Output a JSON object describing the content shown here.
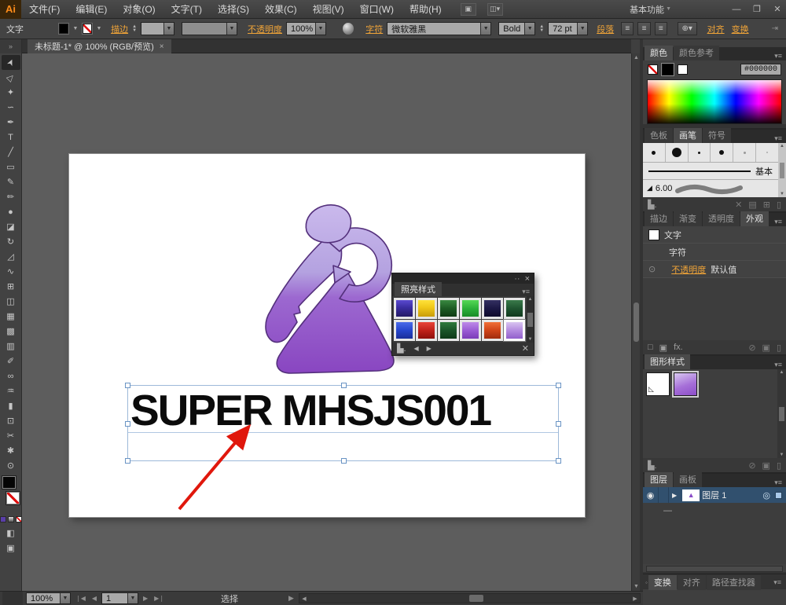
{
  "colors": {
    "accent_orange": "#f0a438",
    "selection_blue": "#9db9d9",
    "canvas_gray": "#5d5d5d",
    "layer_selected_blue": "#31506e",
    "arrow_red": "#e0170c",
    "logo_purple_light": "#cdbcee",
    "logo_purple_dark": "#8844c0",
    "fill_color": "#000000"
  },
  "menubar": {
    "app_icon": "Ai",
    "items": [
      "文件(F)",
      "编辑(E)",
      "对象(O)",
      "文字(T)",
      "选择(S)",
      "效果(C)",
      "视图(V)",
      "窗口(W)",
      "帮助(H)"
    ],
    "workspace": "基本功能",
    "win_min": "—",
    "win_restore": "❐",
    "win_close": "✕"
  },
  "controlbar": {
    "context_label": "文字",
    "stroke_label": "描边",
    "opacity_label": "不透明度",
    "opacity_value": "100%",
    "character_label": "字符",
    "font_family": "微软雅黑",
    "font_style": "Bold",
    "font_size": "72 pt",
    "paragraph_label": "段落",
    "align_label": "对齐",
    "transform_label": "变换"
  },
  "document_tab": {
    "title": "未标题-1* @ 100% (RGB/预览)",
    "close": "×"
  },
  "toolbar": {
    "tools": [
      {
        "name": "selection",
        "glyph": "➤"
      },
      {
        "name": "direct-selection",
        "glyph": "▷"
      },
      {
        "name": "magic-wand",
        "glyph": "✦"
      },
      {
        "name": "lasso",
        "glyph": "∽"
      },
      {
        "name": "pen",
        "glyph": "✒"
      },
      {
        "name": "type",
        "glyph": "T"
      },
      {
        "name": "line-segment",
        "glyph": "╱"
      },
      {
        "name": "rectangle",
        "glyph": "▭"
      },
      {
        "name": "paintbrush",
        "glyph": "✎"
      },
      {
        "name": "pencil",
        "glyph": "✏"
      },
      {
        "name": "blob-brush",
        "glyph": "●"
      },
      {
        "name": "eraser",
        "glyph": "◪"
      },
      {
        "name": "rotate",
        "glyph": "↻"
      },
      {
        "name": "scale",
        "glyph": "◿"
      },
      {
        "name": "width",
        "glyph": "∿"
      },
      {
        "name": "free-transform",
        "glyph": "⊞"
      },
      {
        "name": "shape-builder",
        "glyph": "◫"
      },
      {
        "name": "perspective-grid",
        "glyph": "▦"
      },
      {
        "name": "mesh",
        "glyph": "▩"
      },
      {
        "name": "gradient",
        "glyph": "▥"
      },
      {
        "name": "eyedropper",
        "glyph": "✐"
      },
      {
        "name": "blend",
        "glyph": "∞"
      },
      {
        "name": "symbol-sprayer",
        "glyph": "♒"
      },
      {
        "name": "column-graph",
        "glyph": "▮"
      },
      {
        "name": "artboard",
        "glyph": "⊡"
      },
      {
        "name": "slice",
        "glyph": "✂"
      },
      {
        "name": "hand",
        "glyph": "✱"
      },
      {
        "name": "zoom",
        "glyph": "⊙"
      }
    ]
  },
  "canvas": {
    "headline": "SUPER MHSJS001"
  },
  "float_panel": {
    "title": "照亮样式",
    "collapse": "··",
    "close": "×",
    "menu_icon": "▾≡",
    "swatches": [
      {
        "name": "style-indigo",
        "css": "background:linear-gradient(180deg,#5a49d0,#3a2da0 45%,#241a66)"
      },
      {
        "name": "style-yellow",
        "css": "background:linear-gradient(180deg,#ffe23a,#f0c818 45%,#c89c0a)"
      },
      {
        "name": "style-dark-green",
        "css": "background:linear-gradient(180deg,#3a8a40,#1d5c24 50%,#0f3a14)"
      },
      {
        "name": "style-green",
        "css": "background:linear-gradient(180deg,#55d855,#2cb23a 50%,#1a8c28)"
      },
      {
        "name": "style-navy",
        "css": "background:linear-gradient(180deg,#343061,#1c1845 50%,#0e0b2c)"
      },
      {
        "name": "style-forest",
        "css": "background:linear-gradient(180deg,#3a7a4a,#1f5530 50%,#113a1e)"
      },
      {
        "name": "style-blue",
        "css": "background:linear-gradient(180deg,#4a6ae8,#2545cc 50%,#1a2f99)"
      },
      {
        "name": "style-red",
        "css": "background:linear-gradient(180deg,#e84438,#c0211a 50%,#8e100c)"
      },
      {
        "name": "style-green-swirl",
        "css": "background:linear-gradient(180deg,#2f7a3c,#1a5528 50%,#0e3a18)"
      },
      {
        "name": "style-purple",
        "css": "background:linear-gradient(180deg,#bd8ae8,#9a5cd4 50%,#7a3cb8)"
      },
      {
        "name": "style-orange-red",
        "css": "background:linear-gradient(180deg,#f07038,#d04418 50%,#a02c0e)"
      },
      {
        "name": "style-light-purple",
        "css": "background:linear-gradient(180deg,#d8c4f0,#b48ce0 50%,#9260cc)"
      }
    ]
  },
  "dock": {
    "color": {
      "tab_color": "颜色",
      "tab_guide": "颜色参考",
      "hex_label": "#",
      "hex_value": "000000"
    },
    "brushes": {
      "tab_swatches": "色板",
      "tab_brushes": "画笔",
      "tab_symbols": "符号",
      "basic_label": "基本",
      "size_value": "6.00"
    },
    "appearance": {
      "tab_stroke": "描边",
      "tab_gradient": "渐变",
      "tab_transparency": "透明度",
      "tab_appearance": "外观",
      "row_type": "文字",
      "row_characters": "字符",
      "row_opacity": "不透明度",
      "row_opacity_value": "默认值",
      "fx": "fx."
    },
    "graphic_styles": {
      "tab": "图形样式"
    },
    "layers": {
      "tab_layers": "图层",
      "tab_artboards": "画板",
      "layer_name": "图层 1",
      "sub_dash": "—"
    },
    "bottom_tabs": [
      "变换",
      "对齐",
      "路径查找器"
    ]
  },
  "status": {
    "zoom": "100%",
    "page": "1",
    "tool": "选择"
  }
}
